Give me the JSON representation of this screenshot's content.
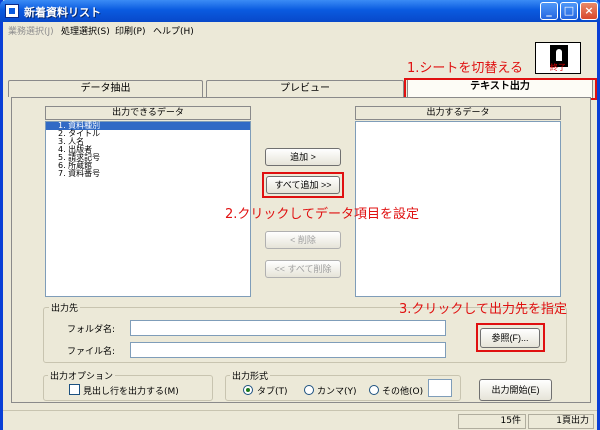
{
  "window": {
    "title": "新着資料リスト",
    "minimize": "_",
    "maximize": "□",
    "close": "×"
  },
  "menu": [
    {
      "label": "業務選択(J)",
      "disabled": true
    },
    {
      "label": "処理選択(S)",
      "disabled": false
    },
    {
      "label": "印刷(P)",
      "disabled": false
    },
    {
      "label": "ヘルプ(H)",
      "disabled": false
    }
  ],
  "toolbar": {
    "exit_label": "終了"
  },
  "annotations": {
    "step1": "1.シートを切替える",
    "step2": "2.クリックしてデータ項目を設定",
    "step3": "3.クリックして出力先を指定"
  },
  "tabs": [
    {
      "label": "データ抽出",
      "active": false
    },
    {
      "label": "プレビュー",
      "active": false
    },
    {
      "label": "テキスト出力",
      "active": true
    }
  ],
  "lists": {
    "available_header": "出力できるデータ",
    "output_header": "出力するデータ",
    "available_items": [
      "1. 資料種別",
      "2. タイトル",
      "3. 人名",
      "4. 出版者",
      "5. 請求記号",
      "6. 所蔵館",
      "7. 資料番号"
    ],
    "selected_index": 0
  },
  "buttons": {
    "add": "追加 >",
    "add_all": "すべて追加 >>",
    "remove": "< 削除",
    "remove_all": "<< すべて削除",
    "browse": "参照(F)...",
    "start_output": "出力開始(E)"
  },
  "destination": {
    "group_label": "出力先",
    "folder_label": "フォルダ名:",
    "folder_value": "",
    "file_label": "ファイル名:",
    "file_value": ""
  },
  "output_options": {
    "group_label": "出力オプション",
    "header_row_label": "見出し行を出力する(M)",
    "header_row_checked": false
  },
  "output_format": {
    "group_label": "出力形式",
    "options": [
      "タブ(T)",
      "カンマ(Y)",
      "その他(O)"
    ],
    "selected": 0,
    "other_value": ""
  },
  "status": {
    "count": "15件",
    "page": "1頁出力"
  },
  "colors": {
    "annotation": "#e01010",
    "selection": "#316ac5",
    "titlebar": "#0a5be0"
  }
}
